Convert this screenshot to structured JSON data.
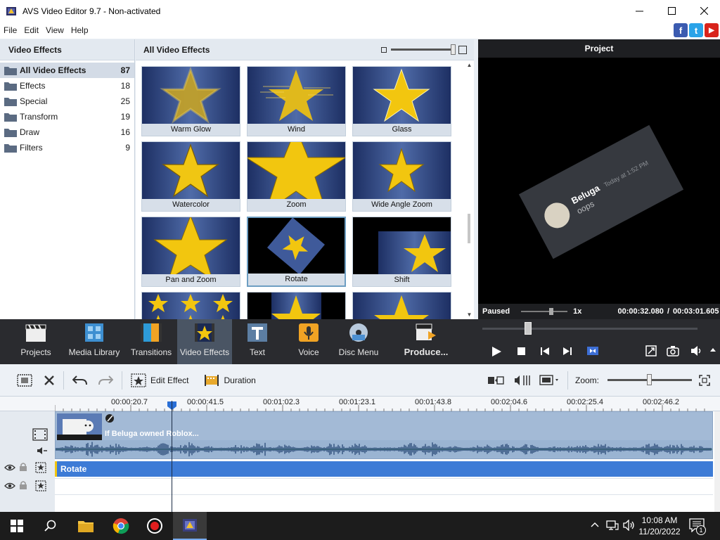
{
  "window": {
    "title": "AVS Video Editor 9.7 - Non-activated"
  },
  "menu": [
    "File",
    "Edit",
    "View",
    "Help"
  ],
  "social": {
    "facebook": "f",
    "twitter": "t",
    "youtube": "▶"
  },
  "left_panel": {
    "title": "Video Effects",
    "categories": [
      {
        "label": "All Video Effects",
        "count": "87",
        "selected": true
      },
      {
        "label": "Effects",
        "count": "18"
      },
      {
        "label": "Special",
        "count": "25"
      },
      {
        "label": "Transform",
        "count": "19"
      },
      {
        "label": "Draw",
        "count": "16"
      },
      {
        "label": "Filters",
        "count": "9"
      }
    ]
  },
  "effects_panel": {
    "title": "All Video Effects",
    "effects": [
      {
        "label": "Warm Glow"
      },
      {
        "label": "Wind"
      },
      {
        "label": "Glass"
      },
      {
        "label": "Watercolor"
      },
      {
        "label": "Zoom"
      },
      {
        "label": "Wide Angle Zoom"
      },
      {
        "label": "Pan and Zoom"
      },
      {
        "label": "Rotate",
        "selected": true
      },
      {
        "label": "Shift"
      }
    ]
  },
  "preview": {
    "title": "Project",
    "card": {
      "name": "Beluga",
      "time": "Today at 1:52 PM",
      "message": "oops"
    },
    "status": "Paused",
    "speed": "1x",
    "current_time": "00:00:32.080",
    "separator": "/",
    "total_time": "00:03:01.605"
  },
  "toolbar": {
    "buttons": [
      {
        "label": "Projects",
        "icon": "clapper-icon"
      },
      {
        "label": "Media Library",
        "icon": "film-grid-icon"
      },
      {
        "label": "Transitions",
        "icon": "transitions-icon"
      },
      {
        "label": "Video Effects",
        "icon": "star-film-icon",
        "selected": true
      },
      {
        "label": "Text",
        "icon": "text-t-icon"
      },
      {
        "label": "Voice",
        "icon": "microphone-icon"
      },
      {
        "label": "Disc Menu",
        "icon": "disc-icon"
      },
      {
        "label": "Produce...",
        "icon": "produce-clapper-icon"
      }
    ]
  },
  "timeline_toolbar": {
    "edit_effect": "Edit Effect",
    "duration": "Duration",
    "zoom_label": "Zoom:"
  },
  "timeline": {
    "ruler": [
      "00:00:20.7",
      "00:00:41.5",
      "00:01:02.3",
      "00:01:23.1",
      "00:01:43.8",
      "00:02:04.6",
      "00:02:25.4",
      "00:02:46.2"
    ],
    "clip_title": "If Beluga owned Roblox...",
    "effect_track": "Rotate",
    "playhead_fraction": 0.177
  },
  "taskbar": {
    "time": "10:08 AM",
    "date": "11/20/2022",
    "notifications": "1"
  }
}
